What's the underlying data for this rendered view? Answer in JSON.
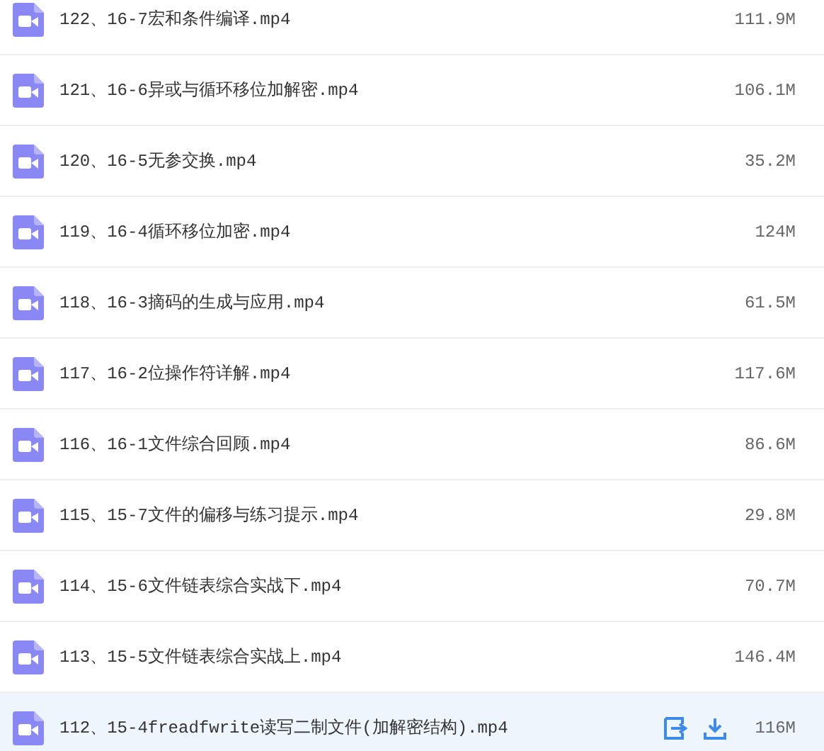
{
  "files": [
    {
      "name": "122、16-7宏和条件编译.mp4",
      "size": "111.9M",
      "selected": false
    },
    {
      "name": "121、16-6异或与循环移位加解密.mp4",
      "size": "106.1M",
      "selected": false
    },
    {
      "name": "120、16-5无参交换.mp4",
      "size": "35.2M",
      "selected": false
    },
    {
      "name": "119、16-4循环移位加密.mp4",
      "size": "124M",
      "selected": false
    },
    {
      "name": "118、16-3摘码的生成与应用.mp4",
      "size": "61.5M",
      "selected": false
    },
    {
      "name": "117、16-2位操作符详解.mp4",
      "size": "117.6M",
      "selected": false
    },
    {
      "name": "116、16-1文件综合回顾.mp4",
      "size": "86.6M",
      "selected": false
    },
    {
      "name": "115、15-7文件的偏移与练习提示.mp4",
      "size": "29.8M",
      "selected": false
    },
    {
      "name": "114、15-6文件链表综合实战下.mp4",
      "size": "70.7M",
      "selected": false
    },
    {
      "name": "113、15-5文件链表综合实战上.mp4",
      "size": "146.4M",
      "selected": false
    },
    {
      "name": "112、15-4freadfwrite读写二制文件(加解密结构).mp4",
      "size": "116M",
      "selected": true
    }
  ]
}
